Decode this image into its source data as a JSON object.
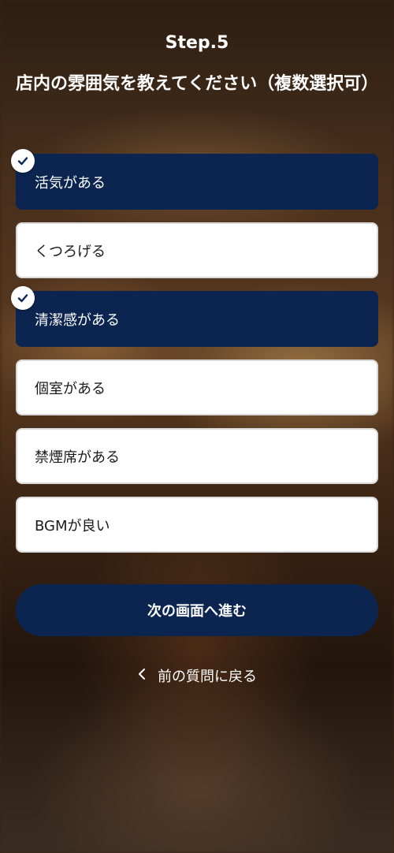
{
  "step_label": "Step.5",
  "question": "店内の雰囲気を教えてください（複数選択可）",
  "options": [
    {
      "label": "活気がある",
      "selected": true
    },
    {
      "label": "くつろげる",
      "selected": false
    },
    {
      "label": "清潔感がある",
      "selected": true
    },
    {
      "label": "個室がある",
      "selected": false
    },
    {
      "label": "禁煙席がある",
      "selected": false
    },
    {
      "label": "BGMが良い",
      "selected": false
    }
  ],
  "next_button_label": "次の画面へ進む",
  "back_link_label": "前の質問に戻る",
  "back_icon": "chevron-left-icon",
  "check_icon": "checkmark-icon",
  "colors": {
    "selected_bg": "#0b2550",
    "option_bg": "#ffffff",
    "text_light": "#ffffff"
  }
}
